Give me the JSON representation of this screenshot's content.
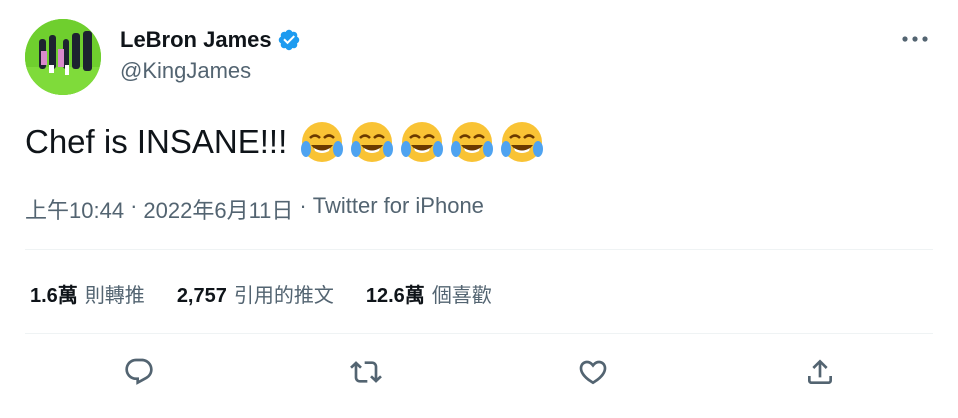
{
  "author": {
    "name": "LeBron James",
    "handle": "@KingJames",
    "avatar_color": "#6fcf2e",
    "verified_color": "#1d9bf0"
  },
  "tweet": {
    "text": "Chef is INSANE!!!",
    "emojis": [
      "face-with-tears-of-joy",
      "face-with-tears-of-joy",
      "face-with-tears-of-joy",
      "face-with-tears-of-joy",
      "face-with-tears-of-joy"
    ],
    "time": "上午10:44",
    "separator": "·",
    "date": "2022年6月11日",
    "source": "Twitter for iPhone"
  },
  "stats": {
    "retweets_count": "1.6萬",
    "retweets_label": "則轉推",
    "quotes_count": "2,757",
    "quotes_label": "引用的推文",
    "likes_count": "12.6萬",
    "likes_label": "個喜歡"
  },
  "icons": {
    "more": "more-icon",
    "reply": "reply-icon",
    "retweet": "retweet-icon",
    "like": "heart-icon",
    "share": "share-icon"
  }
}
